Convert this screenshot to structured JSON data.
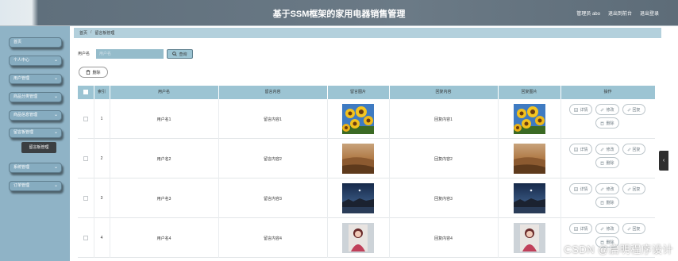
{
  "header": {
    "title": "基于SSM框架的家用电器销售管理",
    "links": [
      "管理员 abo",
      "退出到前台",
      "退出登录"
    ]
  },
  "sidebar": {
    "items": [
      {
        "label": "首页",
        "chevron": false
      },
      {
        "label": "个人中心",
        "chevron": true
      },
      {
        "label": "用户管理",
        "chevron": true
      },
      {
        "label": "商品分类管理",
        "chevron": true
      },
      {
        "label": "商品信息管理",
        "chevron": true
      },
      {
        "label": "留言板管理",
        "chevron": true
      },
      {
        "label": "系统管理",
        "chevron": true
      },
      {
        "label": "订单管理",
        "chevron": true
      }
    ],
    "active_sub": "留言板管理"
  },
  "breadcrumb": {
    "home": "首页",
    "current": "留言板管理"
  },
  "search": {
    "label": "用户名",
    "placeholder": "用户名",
    "button": "查询"
  },
  "toolbar": {
    "delete": "删除"
  },
  "table": {
    "columns": [
      "索引",
      "用户名",
      "留言内容",
      "留言图片",
      "回复内容",
      "回复图片",
      "操作"
    ],
    "rows": [
      {
        "index": "1",
        "username": "用户名1",
        "content": "留言内容1",
        "reply": "回复内容1",
        "image": "sunflowers"
      },
      {
        "index": "2",
        "username": "用户名2",
        "content": "留言内容2",
        "reply": "回复内容2",
        "image": "desert"
      },
      {
        "index": "3",
        "username": "用户名3",
        "content": "留言内容3",
        "reply": "回复内容3",
        "image": "night-lake"
      },
      {
        "index": "4",
        "username": "用户名4",
        "content": "留言内容4",
        "reply": "回复内容4",
        "image": "portrait"
      }
    ],
    "actions": {
      "detail": "详情",
      "edit": "修改",
      "reply": "回复",
      "delete": "删除"
    }
  },
  "watermark": "CSDN @启明程序设计",
  "colors": {
    "accent": "#9cc4d3",
    "sidebar": "#8fb3c6",
    "breadcrumb": "#b3d0dc"
  }
}
